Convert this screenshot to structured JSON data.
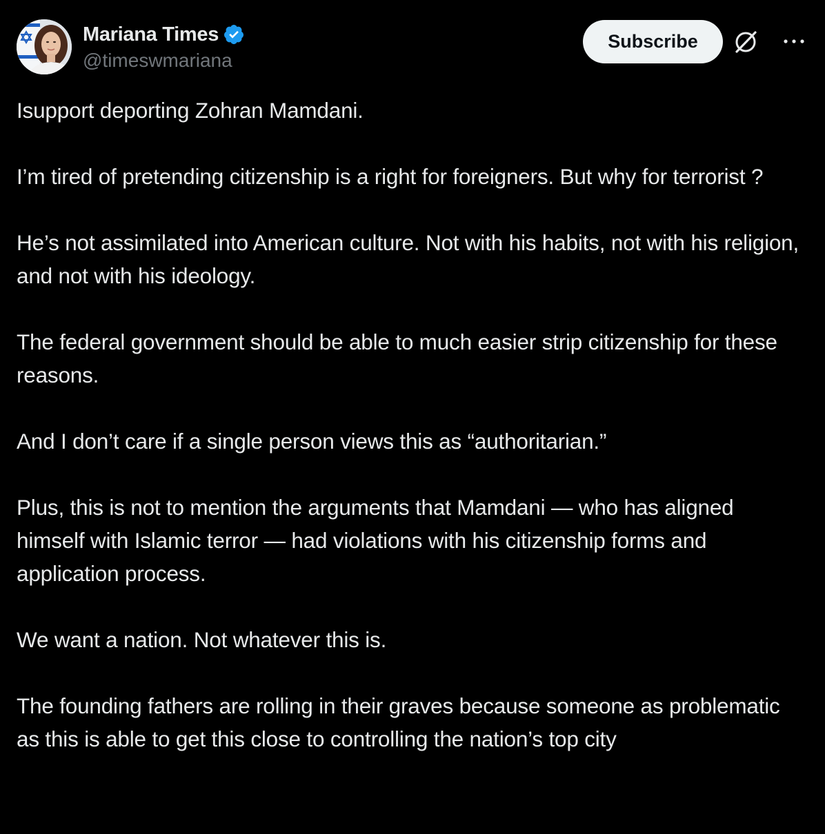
{
  "author": {
    "display_name": "Mariana Times",
    "handle": "@timeswmariana",
    "verified": true,
    "avatar_icon": "profile-photo-with-israel-flag"
  },
  "actions": {
    "subscribe_label": "Subscribe",
    "grok_icon": "grok-icon",
    "more_icon": "more-options-icon"
  },
  "colors": {
    "background": "#000000",
    "text": "#e7e9ea",
    "secondary_text": "#71767b",
    "verified_blue": "#1d9bf0",
    "button_bg": "#eff3f4"
  },
  "post": {
    "paragraphs": [
      "Isupport deporting Zohran Mamdani.",
      "I’m tired of pretending citizenship is a right for foreigners. But why for terrorist ?",
      "He’s not assimilated into American culture. Not with his habits, not with his religion, and not with his ideology.",
      "The federal government should be able to much easier strip citizenship for these reasons.",
      "And I don’t care if a single person views this as “authoritarian.”",
      "Plus, this is not to mention the arguments that Mamdani — who has aligned himself with Islamic terror — had violations with his citizenship forms and application process.",
      "We want a nation. Not whatever this is.",
      "The founding fathers are rolling in their graves because someone as problematic as this is able to get this close to controlling the nation’s top city"
    ]
  }
}
